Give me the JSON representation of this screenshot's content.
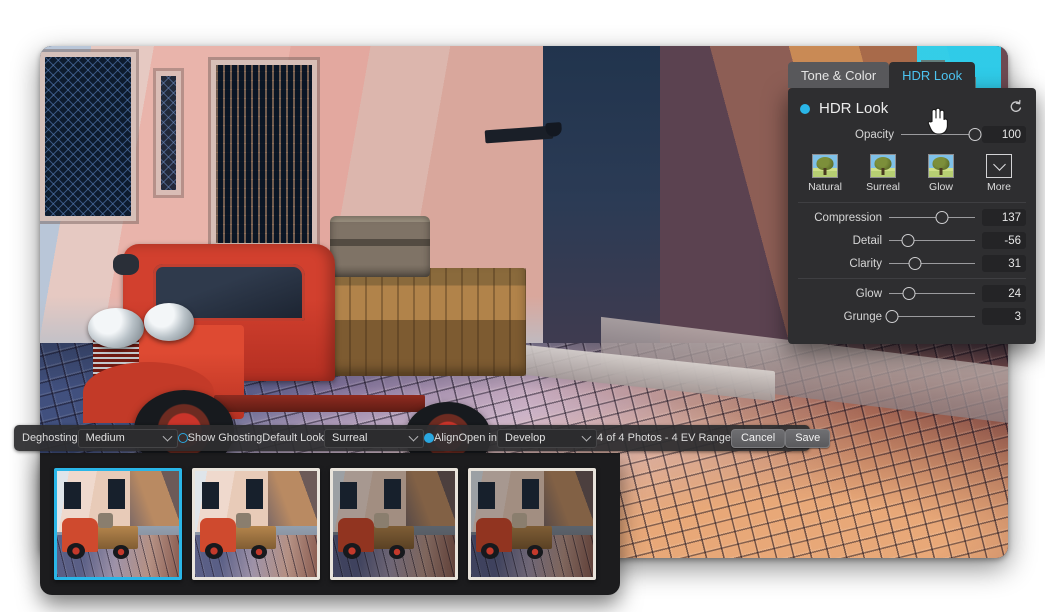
{
  "app": {
    "title": "HDR Merge Editor"
  },
  "panel": {
    "tabs": [
      {
        "label": "Tone & Color",
        "active": false
      },
      {
        "label": "HDR Look",
        "active": true
      }
    ],
    "section_title": "HDR Look",
    "toggle_state": "on",
    "reset_icon": "reset-arrow-icon",
    "opacity": {
      "label": "Opacity",
      "value": "100",
      "position_pct": 100
    },
    "presets": [
      {
        "label": "Natural",
        "icon": "tree-thumbnail-icon"
      },
      {
        "label": "Surreal",
        "icon": "tree-thumbnail-icon"
      },
      {
        "label": "Glow",
        "icon": "tree-thumbnail-icon"
      },
      {
        "label": "More",
        "icon": "chevron-down-icon"
      }
    ],
    "sliders": [
      {
        "label": "Compression",
        "value": "137",
        "position_pct": 62
      },
      {
        "label": "Detail",
        "value": "-56",
        "position_pct": 22
      },
      {
        "label": "Clarity",
        "value": "31",
        "position_pct": 30
      },
      {
        "label": "Glow",
        "value": "24",
        "position_pct": 23
      },
      {
        "label": "Grunge",
        "value": "3",
        "position_pct": 4
      }
    ]
  },
  "toolbar": {
    "deghosting_label": "Deghosting",
    "deghosting_value": "Medium",
    "show_ghosting_label": "Show Ghosting",
    "show_ghosting_checked": false,
    "default_look_label": "Default Look",
    "default_look_value": "Surreal",
    "align_label": "Align",
    "align_checked": true,
    "open_in_label": "Open in",
    "open_in_value": "Develop",
    "status": "4 of 4 Photos - 4 EV Range",
    "cancel_label": "Cancel",
    "save_label": "Save"
  },
  "filmstrip": {
    "thumbnails": [
      {
        "name": "thumbnail-1",
        "selected": true,
        "exposure": "bright"
      },
      {
        "name": "thumbnail-2",
        "selected": false,
        "exposure": "bright"
      },
      {
        "name": "thumbnail-3",
        "selected": false,
        "exposure": "dark"
      },
      {
        "name": "thumbnail-4",
        "selected": false,
        "exposure": "dark"
      }
    ]
  },
  "preview": {
    "description": "Red vintage pickup truck parked on a cobblestone street in an old European alley at dusk"
  },
  "colors": {
    "accent": "#2ab6e8",
    "tab_active_text": "#4cc3f0",
    "panel_bg": "#2e2e30",
    "toolbar_bg": "#2e2e30",
    "filmstrip_bg": "#1c1c1e",
    "selection": "#2ab6e8"
  },
  "cursor": {
    "icon": "pointing-hand-cursor"
  }
}
